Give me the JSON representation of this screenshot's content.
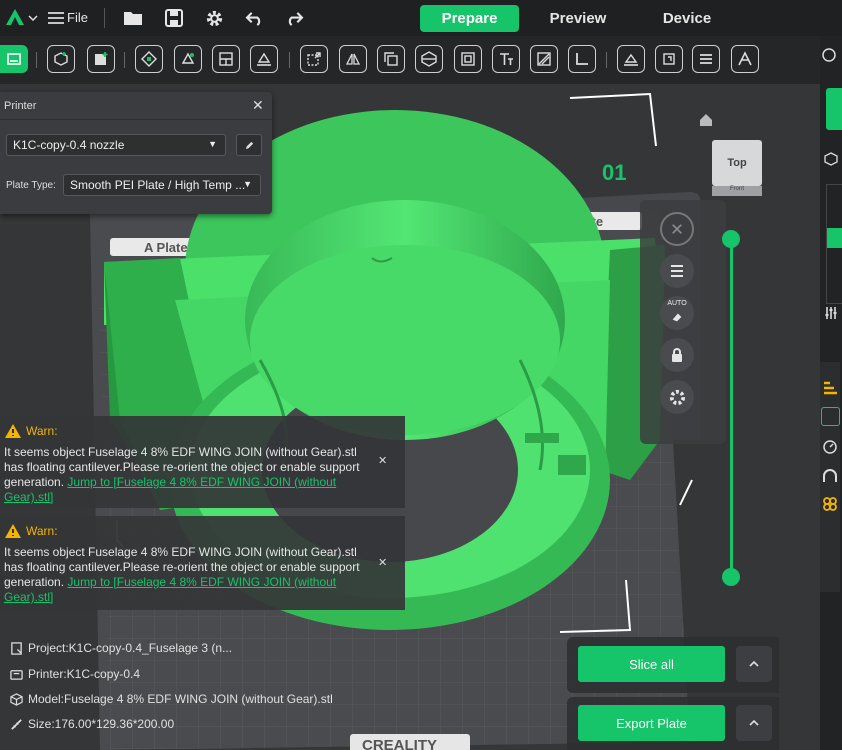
{
  "menu": {
    "file_label": "File"
  },
  "tabs": [
    {
      "label": "Prepare",
      "active": true
    },
    {
      "label": "Preview",
      "active": false
    },
    {
      "label": "Device",
      "active": false
    }
  ],
  "printer_panel": {
    "title": "Printer",
    "printer_value": "K1C-copy-0.4 nozzle",
    "plate_type_label": "Plate Type:",
    "plate_type_value": "Smooth PEI Plate / High Temp ..."
  },
  "viewport": {
    "plate_label_left": "A Plate",
    "plate_label_right": "Plate",
    "plate_number": "01",
    "view_cube_label": "Top",
    "view_cube_sub": "Front",
    "auto_label": "AUTO",
    "bed_brand": "CREALITY"
  },
  "warnings": [
    {
      "title": "Warn:",
      "message": "It seems object Fuselage 4 8% EDF WING JOIN (without Gear).stl has floating cantilever.Please re-orient the object or enable support generation.",
      "link": "Jump to [Fuselage 4 8% EDF WING JOIN (without Gear).stl]"
    },
    {
      "title": "Warn:",
      "message": "It seems object Fuselage 4 8% EDF WING JOIN (without Gear).stl has floating cantilever.Please re-orient the object or enable support generation.",
      "link": "Jump to [Fuselage 4 8% EDF WING JOIN (without Gear).stl]"
    }
  ],
  "info": {
    "project": "Project:K1C-copy-0.4_Fuselage 3 (n...",
    "printer": "Printer:K1C-copy-0.4",
    "model": "Model:Fuselage 4 8% EDF WING JOIN (without Gear).stl",
    "size": "Size:176.00*129.36*200.00"
  },
  "actions": {
    "slice_all": "Slice all",
    "export_plate": "Export Plate"
  },
  "colors": {
    "accent": "#16c469",
    "model": "#4be06a",
    "warn": "#f4b400"
  },
  "icons": [
    "logo-icon",
    "menu-icon",
    "open-folder-icon",
    "save-icon",
    "settings-icon",
    "undo-icon",
    "redo-icon",
    "home-icon",
    "lock-icon",
    "gear-icon",
    "close-icon",
    "chevron-up-icon",
    "warning-icon"
  ]
}
